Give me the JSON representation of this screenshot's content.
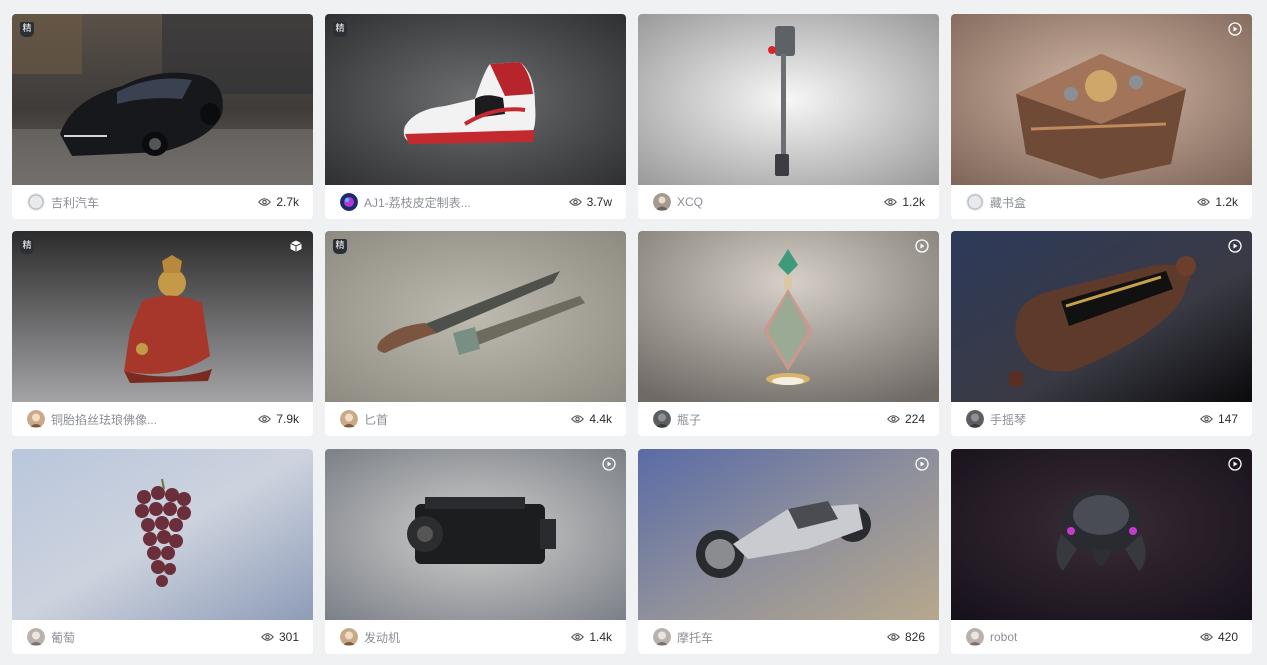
{
  "badge_label": "精",
  "cards": [
    {
      "author": "吉利汽车",
      "views": "2.7k",
      "featured": true,
      "corner_icon": "none",
      "avatar": "default-avatar-icon"
    },
    {
      "author": "AJ1-荔枝皮定制表...",
      "views": "3.7w",
      "featured": true,
      "corner_icon": "none",
      "avatar": "logo-avatar"
    },
    {
      "author": "XCQ",
      "views": "1.2k",
      "featured": false,
      "corner_icon": "none",
      "avatar": "photo-avatar"
    },
    {
      "author": "藏书盒",
      "views": "1.2k",
      "featured": false,
      "corner_icon": "play-icon",
      "avatar": "default-avatar-icon"
    },
    {
      "author": "铜胎掐丝珐琅佛像...",
      "views": "7.9k",
      "featured": true,
      "corner_icon": "cube-icon",
      "avatar": "photo-avatar"
    },
    {
      "author": "匕首",
      "views": "4.4k",
      "featured": true,
      "corner_icon": "none",
      "avatar": "photo-avatar"
    },
    {
      "author": "瓶子",
      "views": "224",
      "featured": false,
      "corner_icon": "play-icon",
      "avatar": "photo-avatar"
    },
    {
      "author": "手摇琴",
      "views": "147",
      "featured": false,
      "corner_icon": "play-icon",
      "avatar": "photo-avatar"
    },
    {
      "author": "葡萄",
      "views": "301",
      "featured": false,
      "corner_icon": "none",
      "avatar": "photo-avatar"
    },
    {
      "author": "发动机",
      "views": "1.4k",
      "featured": false,
      "corner_icon": "play-icon",
      "avatar": "photo-avatar"
    },
    {
      "author": "摩托车",
      "views": "826",
      "featured": false,
      "corner_icon": "play-icon",
      "avatar": "photo-avatar"
    },
    {
      "author": "robot",
      "views": "420",
      "featured": false,
      "corner_icon": "play-icon",
      "avatar": "photo-avatar"
    }
  ]
}
